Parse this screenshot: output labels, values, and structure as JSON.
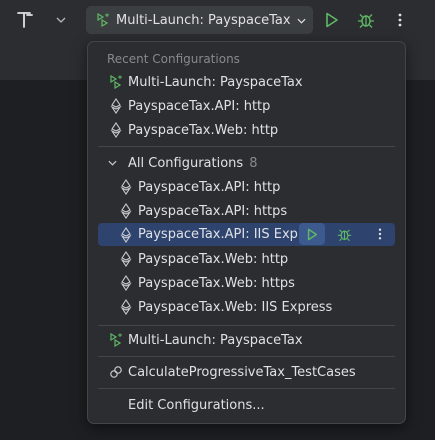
{
  "toolbar": {
    "run_config_label": "Multi-Launch: PayspaceTax"
  },
  "popup": {
    "recent_header": "Recent Configurations",
    "recent_items": [
      {
        "label": "Multi-Launch: PayspaceTax",
        "icon": "multi-launch-icon"
      },
      {
        "label": "PayspaceTax.API: http",
        "icon": "dotnet-icon"
      },
      {
        "label": "PayspaceTax.Web: http",
        "icon": "dotnet-icon"
      }
    ],
    "all_header": "All Configurations",
    "all_count": "8",
    "all_items": [
      {
        "label": "PayspaceTax.API: http",
        "icon": "dotnet-icon"
      },
      {
        "label": "PayspaceTax.API: https",
        "icon": "dotnet-icon"
      },
      {
        "label": "PayspaceTax.API: IIS Express",
        "icon": "dotnet-icon"
      },
      {
        "label": "PayspaceTax.Web: http",
        "icon": "dotnet-icon"
      },
      {
        "label": "PayspaceTax.Web: https",
        "icon": "dotnet-icon"
      },
      {
        "label": "PayspaceTax.Web: IIS Express",
        "icon": "dotnet-icon"
      }
    ],
    "multi_launch_item": "Multi-Launch: PayspaceTax",
    "test_item": "CalculateProgressiveTax_TestCases",
    "edit_item": "Edit Configurations..."
  },
  "colors": {
    "accent_green": "#5fb865",
    "selection": "#2e436e",
    "popup_bg": "#2b2d30"
  }
}
